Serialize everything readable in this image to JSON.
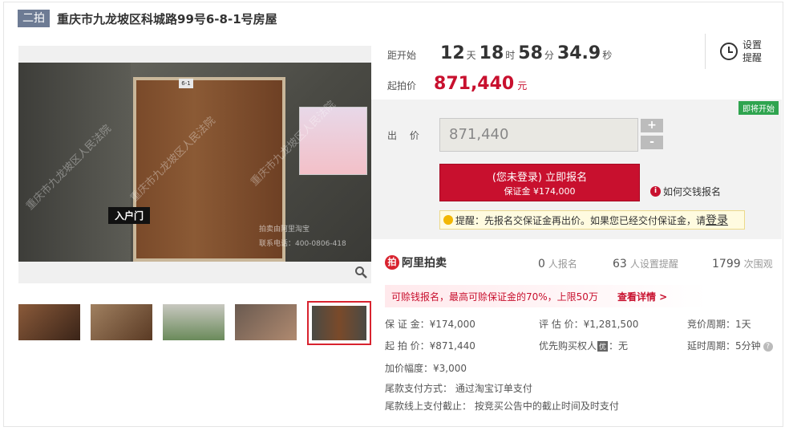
{
  "header": {
    "round": "二拍",
    "title": "重庆市九龙坡区科城路99号6-8-1号房屋"
  },
  "gallery": {
    "door_sign": "6-1",
    "entry_label": "入户门",
    "watermark": "重庆市九龙坡区人民法院",
    "contact_line1": "拍卖由阿里淘宝",
    "contact_line2": "联系电话：400-0806-418",
    "zoom_icon": "magnifier-icon",
    "thumbnails": [
      "room-thumb-1",
      "room-thumb-2",
      "building-thumb-3",
      "room-thumb-4",
      "door-thumb-5"
    ],
    "active_thumb_index": 4
  },
  "countdown": {
    "label": "距开始",
    "days": "12",
    "days_unit": "天",
    "hours": "18",
    "hours_unit": "时",
    "minutes": "58",
    "minutes_unit": "分",
    "seconds": "34.9",
    "seconds_unit": "秒"
  },
  "price": {
    "label": "起拍价",
    "value": "871,440",
    "unit": "元"
  },
  "remind": {
    "label": "设置提醒",
    "icon": "alarm-clock-icon"
  },
  "bid": {
    "soon_badge": "即将开始",
    "label": "出 价",
    "input_value": "871,440",
    "plus": "+",
    "minus": "-",
    "signup_main": "(您未登录) 立即报名",
    "signup_sub": "保证金 ¥174,000",
    "how_pay": "如何交钱报名",
    "tip_text": "提醒：先报名交保证金再出价。如果您已经交付保证金，请",
    "tip_login": "登录"
  },
  "platform": {
    "logo": "阿里拍卖",
    "signups_count": "0",
    "signups_label": "人报名",
    "reminders_count": "63",
    "reminders_label": "人设置提醒",
    "views_count": "1799",
    "views_label": "次围观"
  },
  "promo": {
    "text": "可赊钱报名，最高可赊保证金的70%，上限50万",
    "link": "查看详情 >"
  },
  "details": {
    "deposit": "保 证 金：¥174,000",
    "appraisal": "评 估 价：¥1,281,500",
    "cycle": "竞价周期：1天",
    "start_price": "起 拍 价：¥871,440",
    "priority_prefix": "优先购买权人",
    "priority_badge": "优",
    "priority_suffix": "：无",
    "delay": "延时周期：5分钟",
    "increment": "加价幅度：¥3,000",
    "payment_method": "尾款支付方式：  通过淘宝订单支付",
    "payment_deadline": "尾款线上支付截止：  按竞买公告中的截止时间及时支付"
  },
  "colors": {
    "accent": "#c8102e",
    "badge_gray": "#6d7b94",
    "soon_green": "#2fa44f"
  }
}
